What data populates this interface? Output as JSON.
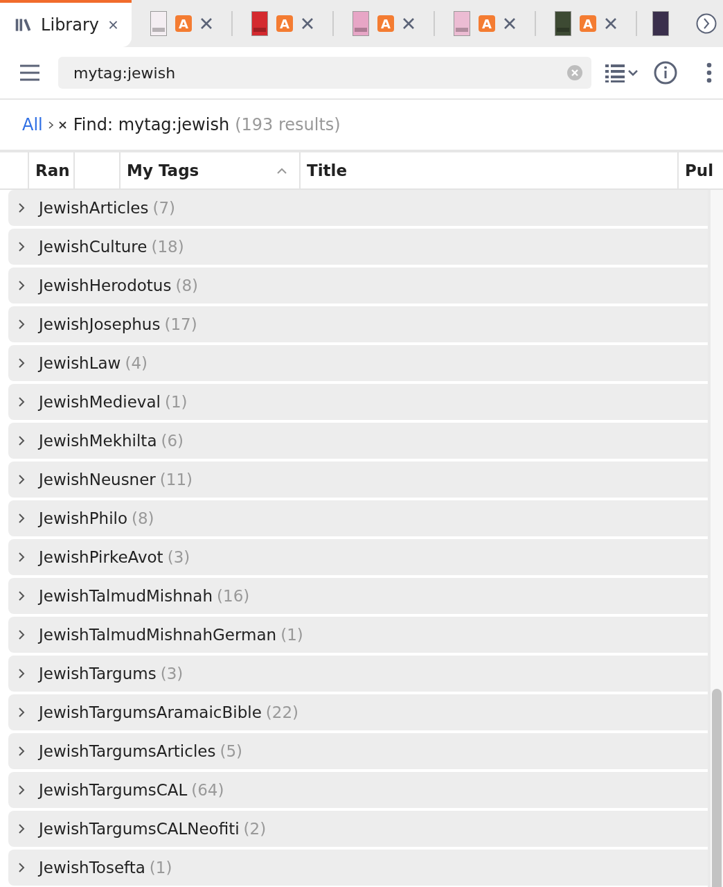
{
  "tabs": [
    {
      "kind": "library",
      "label": "Library",
      "selected": true
    },
    {
      "kind": "document",
      "color": "#f4eef2",
      "badge": "A",
      "selected": false
    },
    {
      "kind": "document",
      "color": "#d42a2f",
      "badge": "A",
      "selected": false
    },
    {
      "kind": "document",
      "color": "#e7a6c6",
      "badge": "A",
      "selected": false
    },
    {
      "kind": "document",
      "color": "#ecbcd3",
      "badge": "A",
      "selected": false
    },
    {
      "kind": "document",
      "color": "#3d4a33",
      "badge": "A",
      "selected": false
    },
    {
      "kind": "partial",
      "color": "#3a2f4c"
    }
  ],
  "search": {
    "value": "mytag:jewish"
  },
  "breadcrumb": {
    "root": "All",
    "find": "Find: mytag:jewish",
    "count": "(193 results)"
  },
  "table": {
    "columns": [
      {},
      {
        "label": "Ran"
      },
      {},
      {
        "label": "My Tags",
        "sorted": true
      },
      {
        "label": "Title"
      },
      {
        "label": "Pul"
      }
    ],
    "rows": [
      {
        "name": "JewishArticles",
        "count": "(7)"
      },
      {
        "name": "JewishCulture",
        "count": "(18)"
      },
      {
        "name": "JewishHerodotus",
        "count": "(8)"
      },
      {
        "name": "JewishJosephus",
        "count": "(17)"
      },
      {
        "name": "JewishLaw",
        "count": "(4)"
      },
      {
        "name": "JewishMedieval",
        "count": "(1)"
      },
      {
        "name": "JewishMekhilta",
        "count": "(6)"
      },
      {
        "name": "JewishNeusner",
        "count": "(11)"
      },
      {
        "name": "JewishPhilo",
        "count": "(8)"
      },
      {
        "name": "JewishPirkeAvot",
        "count": "(3)"
      },
      {
        "name": "JewishTalmudMishnah",
        "count": "(16)"
      },
      {
        "name": "JewishTalmudMishnahGerman",
        "count": "(1)"
      },
      {
        "name": "JewishTargums",
        "count": "(3)"
      },
      {
        "name": "JewishTargumsAramaicBible",
        "count": "(22)"
      },
      {
        "name": "JewishTargumsArticles",
        "count": "(5)"
      },
      {
        "name": "JewishTargumsCAL",
        "count": "(64)"
      },
      {
        "name": "JewishTargumsCALNeofiti",
        "count": "(2)"
      },
      {
        "name": "JewishTosefta",
        "count": "(1)"
      }
    ]
  }
}
